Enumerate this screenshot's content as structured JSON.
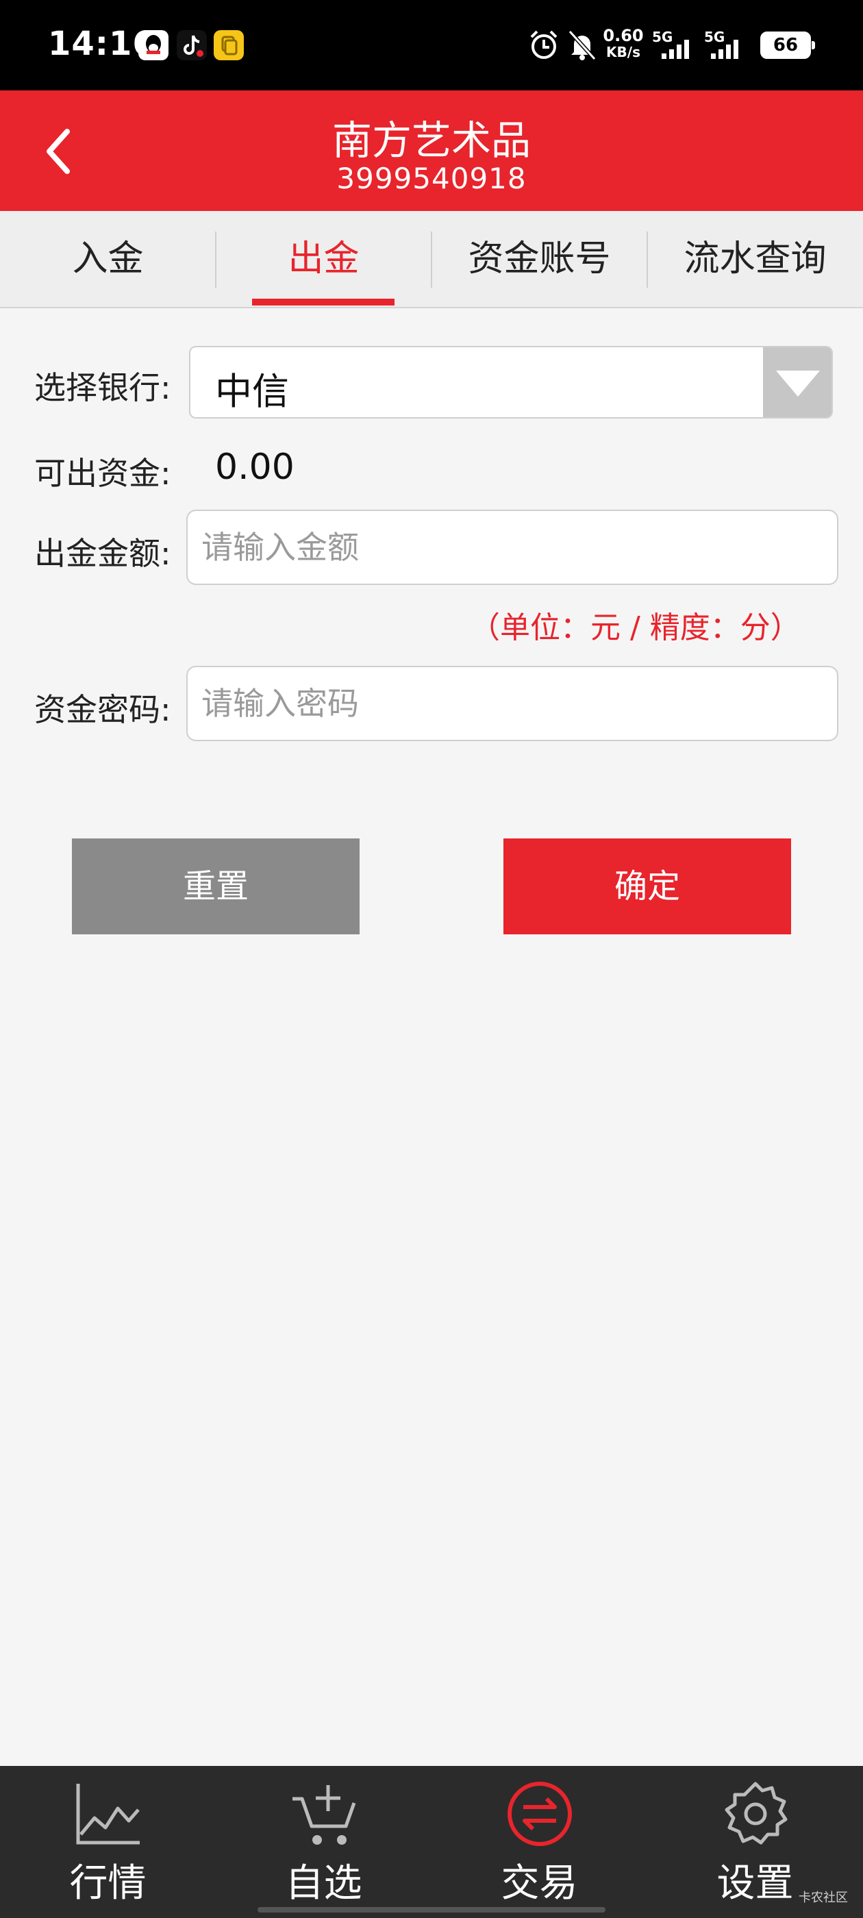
{
  "status": {
    "time": "14:16",
    "net_speed_value": "0.60",
    "net_speed_unit": "KB/s",
    "signal_1": "5G",
    "signal_2": "5G",
    "battery": "66"
  },
  "header": {
    "title": "南方艺术品",
    "subtitle": "3999540918"
  },
  "tabs": [
    {
      "label": "入金"
    },
    {
      "label": "出金"
    },
    {
      "label": "资金账号"
    },
    {
      "label": "流水查询"
    }
  ],
  "form": {
    "bank_label": "选择银行:",
    "bank_value": "中信",
    "balance_label": "可出资金:",
    "balance_value": "0.00",
    "amount_label": "出金金额:",
    "amount_placeholder": "请输入金额",
    "unit_note": "（单位：元 / 精度：分）",
    "password_label": "资金密码:",
    "password_placeholder": "请输入密码"
  },
  "buttons": {
    "reset": "重置",
    "confirm": "确定"
  },
  "nav": [
    {
      "label": "行情",
      "icon": "line-chart-icon"
    },
    {
      "label": "自选",
      "icon": "cart-add-icon"
    },
    {
      "label": "交易",
      "icon": "exchange-icon"
    },
    {
      "label": "设置",
      "icon": "gear-icon"
    }
  ],
  "watermark": "卡农社区",
  "colors": {
    "accent": "#e8242c",
    "nav_background": "#2b2b2b",
    "reset_button": "#8a8a8a"
  }
}
